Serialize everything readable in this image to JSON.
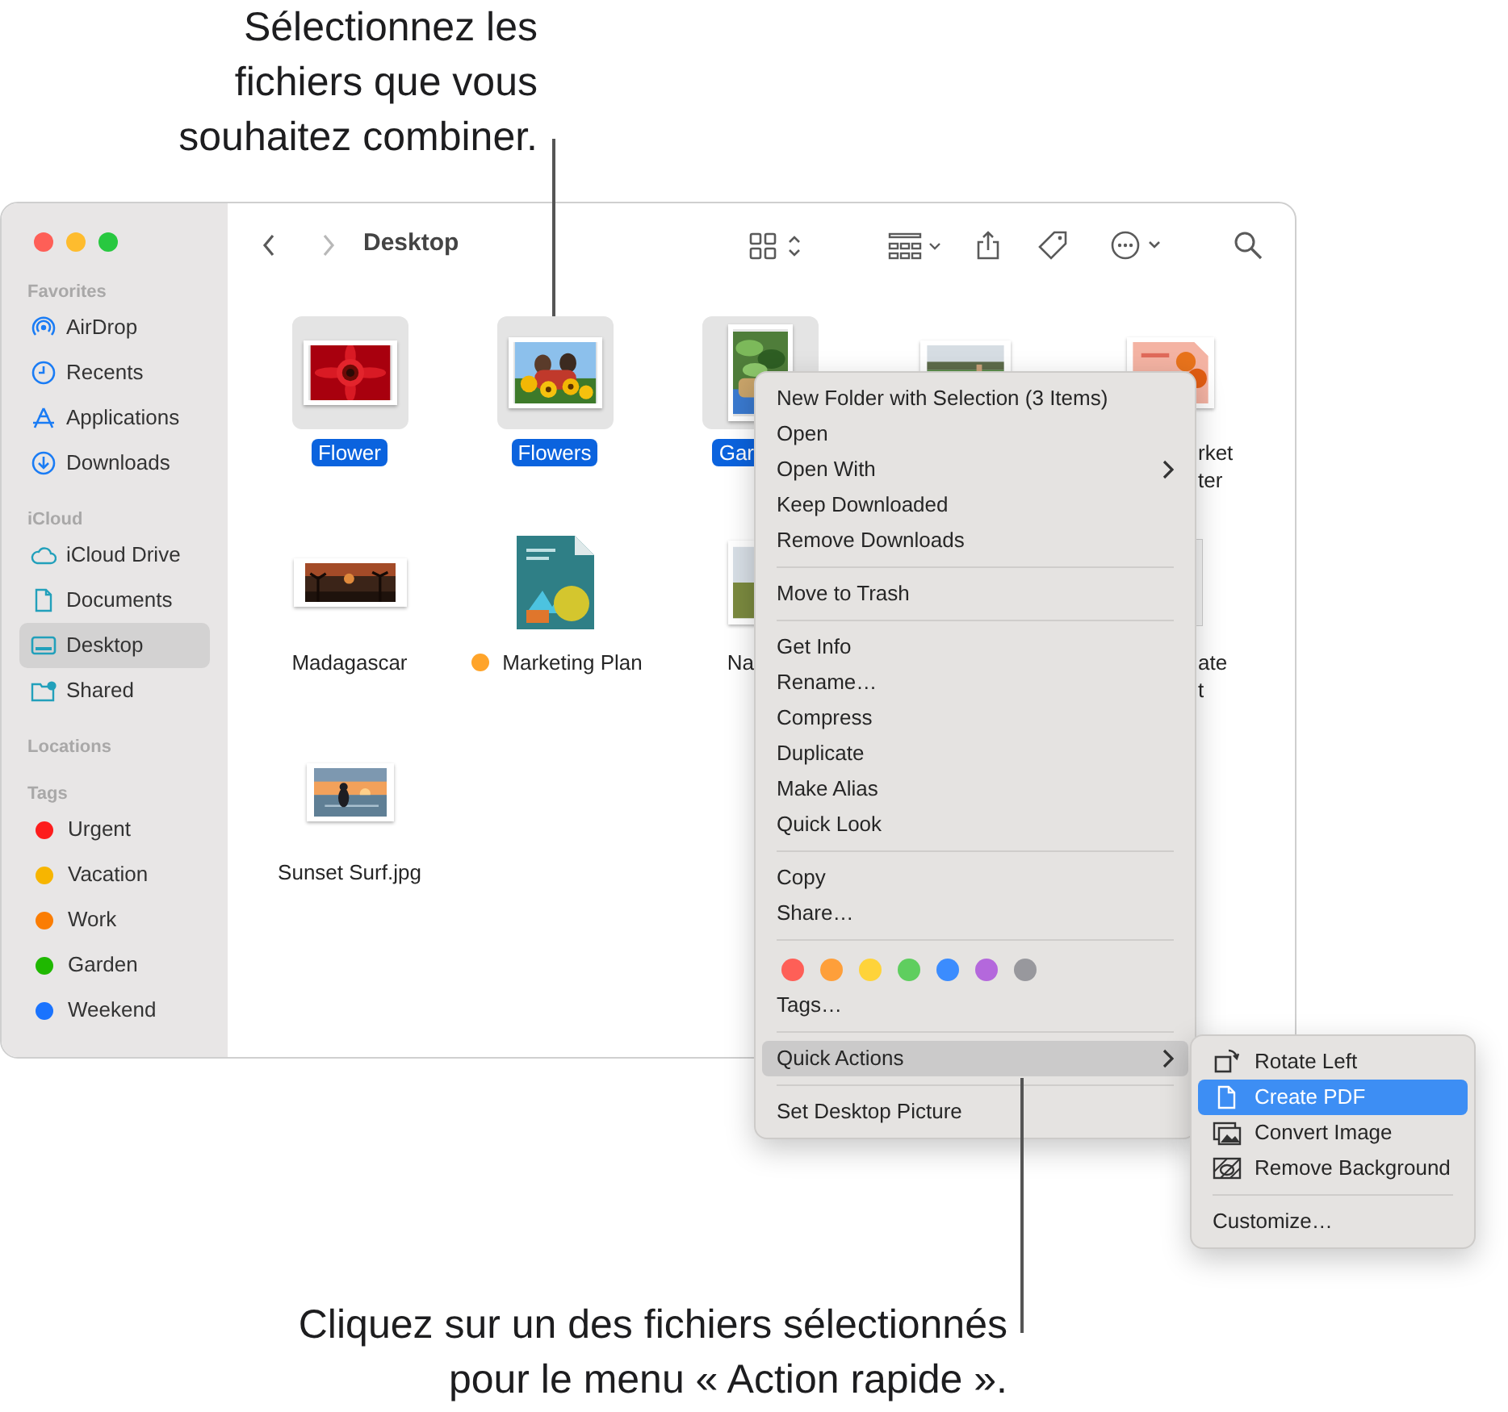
{
  "callouts": [
    {
      "text": "Sélectionnez les\nfichiers que vous\nsouhaitez combiner."
    },
    {
      "text": "Cliquez sur un des fichiers sélectionnés\npour le menu « Action rapide »."
    }
  ],
  "sidebar": {
    "sections": [
      {
        "title": "Favorites",
        "items": [
          {
            "label": "AirDrop",
            "selected": false
          },
          {
            "label": "Recents",
            "selected": false
          },
          {
            "label": "Applications",
            "selected": false
          },
          {
            "label": "Downloads",
            "selected": false
          }
        ]
      },
      {
        "title": "iCloud",
        "items": [
          {
            "label": "iCloud Drive",
            "selected": false
          },
          {
            "label": "Documents",
            "selected": false
          },
          {
            "label": "Desktop",
            "selected": true
          },
          {
            "label": "Shared",
            "selected": false
          }
        ]
      },
      {
        "title": "Locations"
      },
      {
        "title": "Tags",
        "items": [
          {
            "label": "Urgent",
            "selected": false,
            "color": "#fd1d1d"
          },
          {
            "label": "Vacation",
            "selected": false,
            "color": "#f7b500"
          },
          {
            "label": "Work",
            "selected": false,
            "color": "#fb7d03"
          },
          {
            "label": "Garden",
            "selected": false,
            "color": "#1fb800"
          },
          {
            "label": "Weekend",
            "selected": false,
            "color": "#1a73fe"
          }
        ]
      }
    ]
  },
  "toolbar": {
    "title": "Desktop",
    "back_disabled": false,
    "forward_disabled": true
  },
  "files": [
    {
      "label": "Flower",
      "selected": true,
      "kind": "picture"
    },
    {
      "label": "Flowers",
      "selected": true,
      "kind": "picture"
    },
    {
      "label": "Gar",
      "selected": true,
      "kind": "picture"
    },
    {
      "kind": "picture",
      "selected": false
    },
    {
      "label": "rket\nter",
      "selected": false,
      "kind": "picture"
    },
    {
      "label": "Madagascar",
      "selected": false,
      "kind": "picture"
    },
    {
      "label": "Marketing Plan",
      "selected": false,
      "kind": "document",
      "color": "#ffa42a"
    },
    {
      "label": "Na",
      "selected": false,
      "kind": "picture"
    },
    {
      "label": "ate\nt",
      "selected": false,
      "kind": "document"
    },
    {
      "label": "Sunset Surf.jpg",
      "selected": false,
      "kind": "picture"
    }
  ],
  "context_menu": {
    "items": [
      {
        "kind": "item",
        "label": "New Folder with Selection (3 Items)",
        "selected": false
      },
      {
        "kind": "item",
        "label": "Open",
        "selected": false
      },
      {
        "kind": "item",
        "label": "Open With",
        "selected": false,
        "submenu": true
      },
      {
        "kind": "item",
        "label": "Keep Downloaded",
        "selected": false
      },
      {
        "kind": "item",
        "label": "Remove Downloads",
        "selected": false
      },
      {
        "kind": "separator"
      },
      {
        "kind": "item",
        "label": "Move to Trash",
        "selected": false
      },
      {
        "kind": "separator"
      },
      {
        "kind": "item",
        "label": "Get Info",
        "selected": false
      },
      {
        "kind": "item",
        "label": "Rename…",
        "selected": false
      },
      {
        "kind": "item",
        "label": "Compress",
        "selected": false
      },
      {
        "kind": "item",
        "label": "Duplicate",
        "selected": false
      },
      {
        "kind": "item",
        "label": "Make Alias",
        "selected": false
      },
      {
        "kind": "item",
        "label": "Quick Look",
        "selected": false
      },
      {
        "kind": "separator"
      },
      {
        "kind": "item",
        "label": "Copy",
        "selected": false
      },
      {
        "kind": "item",
        "label": "Share…",
        "selected": false
      },
      {
        "kind": "separator"
      },
      {
        "kind": "tags",
        "tags": [
          {
            "color": "#fe5f57"
          },
          {
            "color": "#fe9f3a"
          },
          {
            "color": "#fed33a"
          },
          {
            "color": "#5fce5f"
          },
          {
            "color": "#3b8cfe"
          },
          {
            "color": "#b468dc"
          },
          {
            "color": "#98989d"
          }
        ]
      },
      {
        "kind": "item",
        "label": "Tags…",
        "selected": false
      },
      {
        "kind": "separator"
      },
      {
        "kind": "item",
        "label": "Quick Actions",
        "selected": true,
        "submenu": true
      },
      {
        "kind": "separator"
      },
      {
        "kind": "item",
        "label": "Set Desktop Picture",
        "selected": false
      }
    ]
  },
  "submenu": {
    "items": [
      {
        "kind": "item",
        "label": "Rotate Left",
        "selected": false
      },
      {
        "kind": "item",
        "label": "Create PDF",
        "selected": true
      },
      {
        "kind": "item",
        "label": "Convert Image",
        "selected": false
      },
      {
        "kind": "item",
        "label": "Remove Background",
        "selected": false
      },
      {
        "kind": "separator"
      },
      {
        "kind": "item",
        "label": "Customize…",
        "selected": false
      }
    ]
  }
}
